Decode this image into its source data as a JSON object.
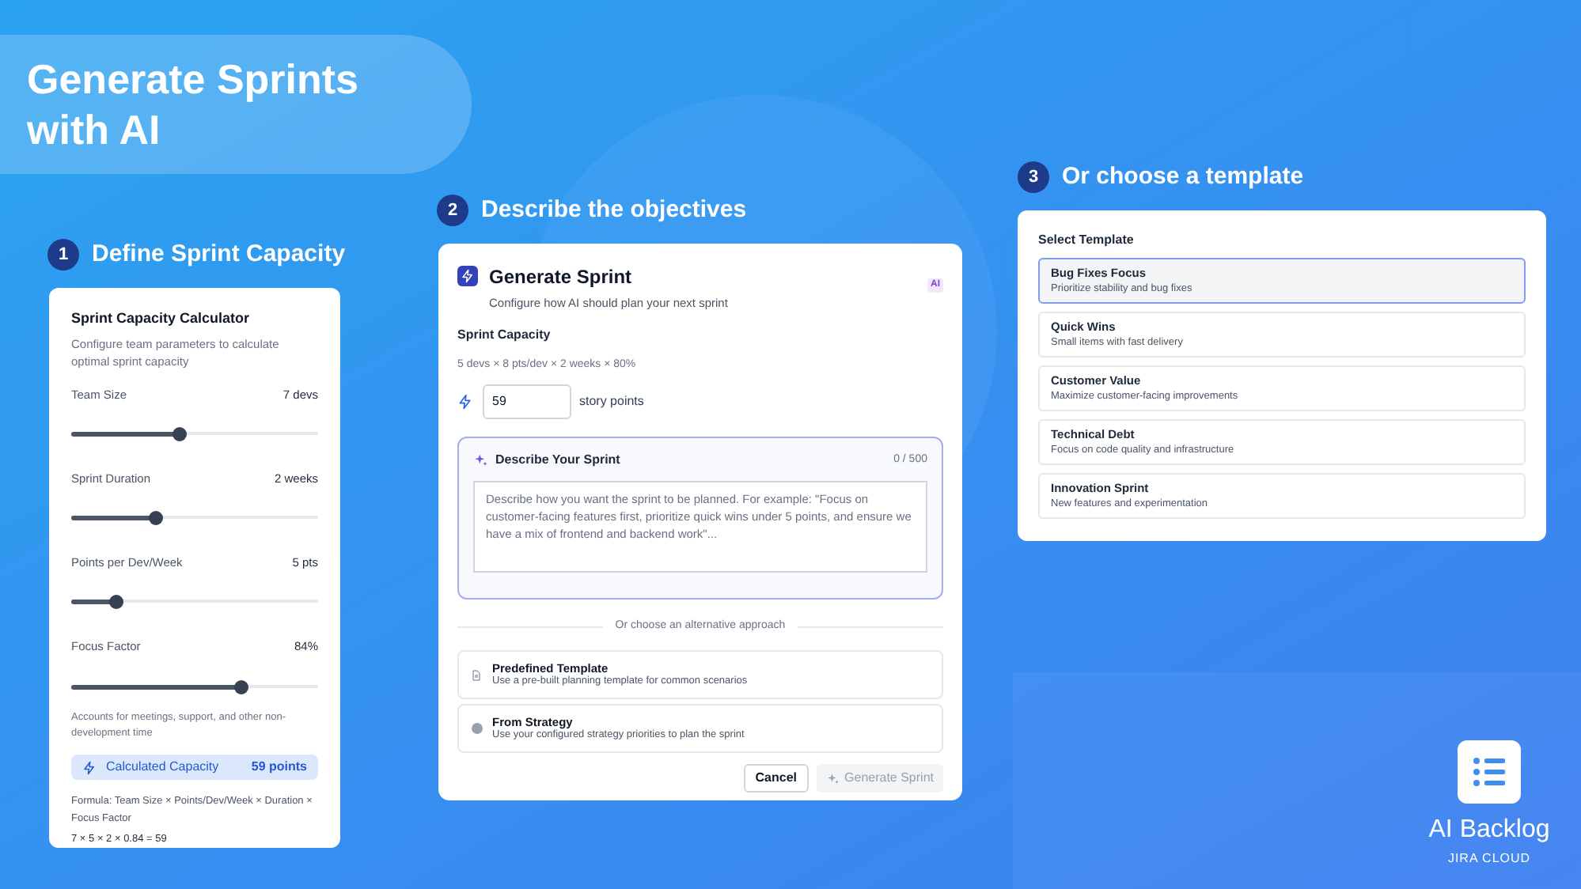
{
  "headline": {
    "title": "Generate Sprints with AI"
  },
  "steps": [
    {
      "number": "1",
      "title": "Define Sprint Capacity"
    },
    {
      "number": "2",
      "title": "Describe the objectives"
    },
    {
      "number": "3",
      "title": "Or choose a template"
    }
  ],
  "calculator": {
    "title": "Sprint Capacity Calculator",
    "subtitle": "Configure team parameters to calculate optimal sprint capacity",
    "sliders": [
      {
        "label": "Team Size",
        "reading": "7 devs",
        "level": 0.44
      },
      {
        "label": "Sprint Duration",
        "reading": "2 weeks",
        "level": 0.34
      },
      {
        "label": "Points per Dev/Week",
        "reading": "5 pts",
        "level": 0.18
      },
      {
        "label": "Focus Factor",
        "reading": "84%",
        "level": 0.69
      }
    ],
    "note": "Accounts for meetings, support, and other non-development time",
    "result": {
      "label": "Calculated Capacity",
      "value": "59 points"
    },
    "formula": "Formula: Team Size × Points/Dev/Week × Duration × Focus Factor",
    "calculation": "7 × 5 × 2 × 0.84 = 59"
  },
  "dialog": {
    "title": "Generate Sprint",
    "subtitle": "Configure how AI should plan your next sprint",
    "badge": "AI",
    "capacity_label": "Sprint Capacity",
    "capacity_formula": "5 devs × 8 pts/dev × 2 weeks × 80%",
    "capacity_value": "59",
    "capacity_unit": "story points",
    "describe": {
      "title": "Describe Your Sprint",
      "counter": "0 / 500",
      "placeholder": "Describe how you want the sprint to be planned. For example: \"Focus on customer-facing features first, prioritize quick wins under 5 points, and ensure we have a mix of frontend and backend work\"..."
    },
    "divider": "Or choose an alternative approach",
    "options": [
      {
        "kind": "document",
        "title": "Predefined Template",
        "description": "Use a pre-built planning template for common scenarios"
      },
      {
        "kind": "strategy",
        "title": "From Strategy",
        "description": "Use your configured strategy priorities to plan the sprint"
      }
    ],
    "buttons": [
      {
        "label": "Cancel",
        "disabled": false
      },
      {
        "label": "Generate Sprint",
        "disabled": true
      }
    ]
  },
  "templates": {
    "title": "Select Template",
    "items": [
      {
        "title": "Bug Fixes Focus",
        "description": "Prioritize stability and bug fixes",
        "selected": true
      },
      {
        "title": "Quick Wins",
        "description": "Small items with fast delivery",
        "selected": false
      },
      {
        "title": "Customer Value",
        "description": "Maximize customer-facing improvements",
        "selected": false
      },
      {
        "title": "Technical Debt",
        "description": "Focus on code quality and infrastructure",
        "selected": false
      },
      {
        "title": "Innovation Sprint",
        "description": "New features and experimentation",
        "selected": false
      }
    ]
  },
  "brand": {
    "name": "AI Backlog",
    "tagline": "JIRA CLOUD"
  }
}
